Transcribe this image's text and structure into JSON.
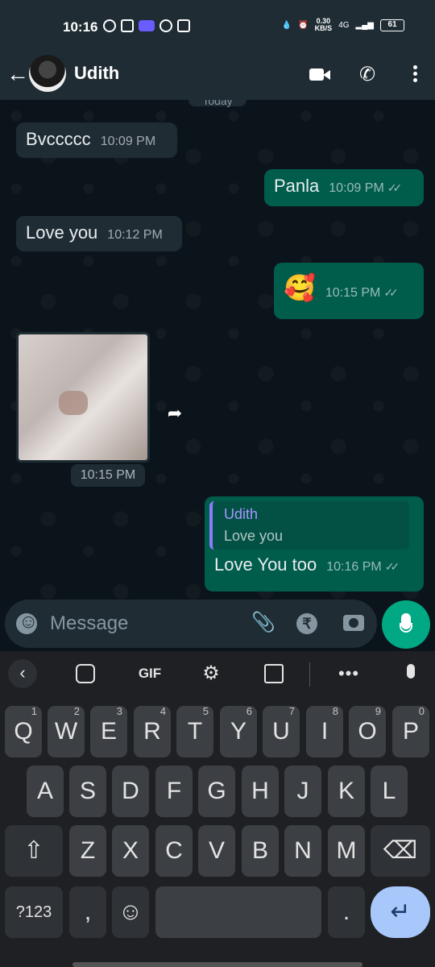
{
  "status_bar": {
    "time": "10:16",
    "net_speed_value": "0.30",
    "net_speed_unit": "KB/S",
    "network": "4G",
    "battery": "61"
  },
  "header": {
    "contact_name": "Udith"
  },
  "chat": {
    "date_chip": "Today",
    "messages": [
      {
        "text": "Bvccccc",
        "time": "10:09 PM"
      },
      {
        "text": "Panla",
        "time": "10:09 PM"
      },
      {
        "text": "Love you",
        "time": "10:12 PM"
      },
      {
        "text": "🥰",
        "time": "10:15 PM"
      },
      {
        "time": "10:15 PM"
      },
      {
        "reply_name": "Udith",
        "reply_text": "Love you",
        "text": "Love You too",
        "time": "10:16 PM"
      }
    ]
  },
  "composer": {
    "placeholder": "Message"
  },
  "keyboard": {
    "toolbar": {
      "gif": "GIF",
      "more": "•••"
    },
    "row1": [
      {
        "k": "Q",
        "h": "1"
      },
      {
        "k": "W",
        "h": "2"
      },
      {
        "k": "E",
        "h": "3"
      },
      {
        "k": "R",
        "h": "4"
      },
      {
        "k": "T",
        "h": "5"
      },
      {
        "k": "Y",
        "h": "6"
      },
      {
        "k": "U",
        "h": "7"
      },
      {
        "k": "I",
        "h": "8"
      },
      {
        "k": "O",
        "h": "9"
      },
      {
        "k": "P",
        "h": "0"
      }
    ],
    "row2": [
      "A",
      "S",
      "D",
      "F",
      "G",
      "H",
      "J",
      "K",
      "L"
    ],
    "row3": [
      "Z",
      "X",
      "C",
      "V",
      "B",
      "N",
      "M"
    ],
    "symbols_key": "?123",
    "comma_key": ",",
    "period_key": "."
  },
  "colors": {
    "accent": "#00a884",
    "outgoing_bubble": "#005c4b",
    "incoming_bubble": "#1f2c34",
    "reply_name": "#a796ff",
    "enter_key": "#a8c7fa"
  }
}
